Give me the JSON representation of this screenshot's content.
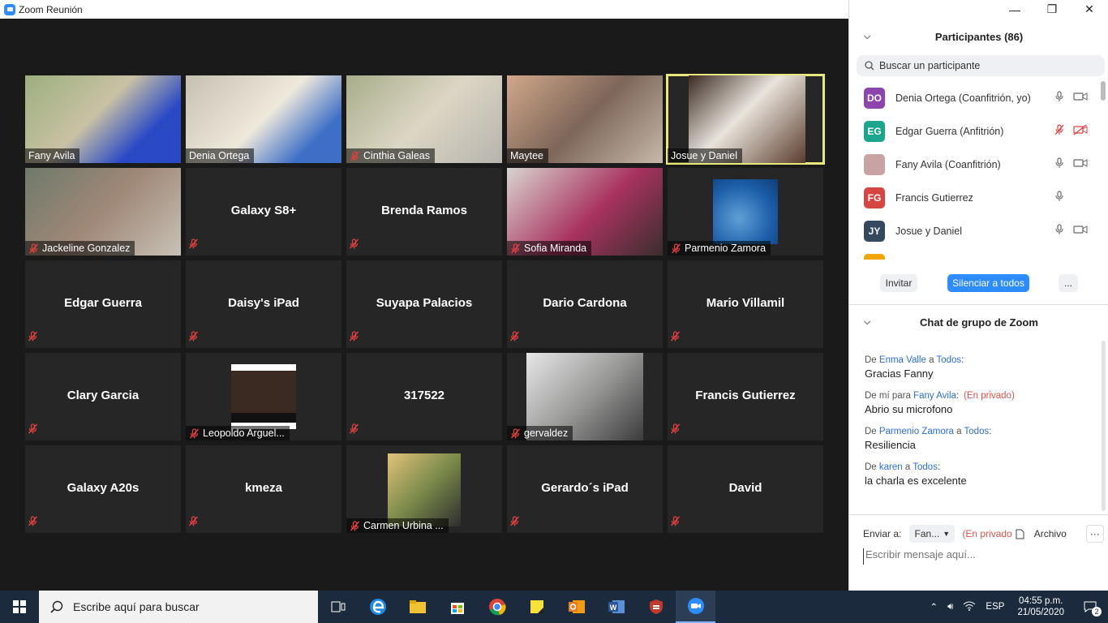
{
  "window": {
    "title": "Zoom Reunión",
    "minimize": "—",
    "restore": "❐",
    "close": "✕"
  },
  "tiles": [
    {
      "name": "Fany Avila",
      "muted": false,
      "video": true
    },
    {
      "name": "Denia Ortega",
      "muted": false,
      "video": true
    },
    {
      "name": "Cinthia Galeas",
      "muted": true,
      "video": true
    },
    {
      "name": "Maytee",
      "muted": false,
      "video": true
    },
    {
      "name": "Josue y Daniel",
      "muted": false,
      "video": true,
      "active": true
    },
    {
      "name": "Jackeline Gonzalez",
      "muted": true,
      "video": true
    },
    {
      "name": "Galaxy S8+",
      "muted": true,
      "video": false
    },
    {
      "name": "Brenda Ramos",
      "muted": true,
      "video": false
    },
    {
      "name": "Sofia Miranda",
      "muted": true,
      "video": true
    },
    {
      "name": "Parmenio Zamora",
      "muted": true,
      "video": false,
      "photo": true
    },
    {
      "name": "Edgar Guerra",
      "muted": true,
      "video": false
    },
    {
      "name": "Daisy's iPad",
      "muted": true,
      "video": false
    },
    {
      "name": "Suyapa Palacios",
      "muted": true,
      "video": false
    },
    {
      "name": "Dario Cardona",
      "muted": true,
      "video": false
    },
    {
      "name": "Mario Villamil",
      "muted": true,
      "video": false
    },
    {
      "name": "Clary Garcia",
      "muted": true,
      "video": false
    },
    {
      "name": "Leopoldo Arguel...",
      "muted": true,
      "video": false,
      "photo": true
    },
    {
      "name": "317522",
      "muted": true,
      "video": false
    },
    {
      "name": "gervaldez",
      "muted": true,
      "video": true
    },
    {
      "name": "Francis Gutierrez",
      "muted": true,
      "video": false
    },
    {
      "name": "Galaxy A20s",
      "muted": true,
      "video": false
    },
    {
      "name": "kmeza",
      "muted": true,
      "video": false
    },
    {
      "name": "Carmen Urbina ...",
      "muted": true,
      "video": false,
      "photo": true
    },
    {
      "name": "Gerardo´s iPad",
      "muted": true,
      "video": false
    },
    {
      "name": "David",
      "muted": true,
      "video": false
    }
  ],
  "participants_panel": {
    "title": "Participantes (86)",
    "search_placeholder": "Buscar un participante",
    "items": [
      {
        "initials": "DO",
        "color": "#8e44ad",
        "name": "Denia Ortega (Coanfitrión, yo)",
        "mic_muted": false,
        "cam_off": false
      },
      {
        "initials": "EG",
        "color": "#1aa58c",
        "name": "Edgar Guerra (Anfitrión)",
        "mic_muted": true,
        "cam_off": true
      },
      {
        "initials": "",
        "color": "#c9a3a3",
        "name": "Fany Avila (Coanfitrión)",
        "mic_muted": false,
        "cam_off": false
      },
      {
        "initials": "FG",
        "color": "#d64541",
        "name": "Francis Gutierrez",
        "mic_muted": false,
        "cam_off": null
      },
      {
        "initials": "JY",
        "color": "#34495e",
        "name": "Josue y Daniel",
        "mic_muted": false,
        "cam_off": false
      }
    ],
    "invite": "Invitar",
    "mute_all": "Silenciar a todos",
    "more": "..."
  },
  "chat": {
    "title": "Chat de grupo de Zoom",
    "messages": [
      {
        "prefix": "De ",
        "from": "Enma Valle",
        "mid": " a ",
        "to": "Todos",
        "suffix": ":",
        "private": "",
        "text": "Gracias Fanny"
      },
      {
        "prefix": "De mí para ",
        "from": "Fany Avila",
        "mid": "",
        "to": "",
        "suffix": ":",
        "private": "(En privado)",
        "text": "Abrio su microfono"
      },
      {
        "prefix": "De ",
        "from": "Parmenio Zamora",
        "mid": " a ",
        "to": "Todos",
        "suffix": ":",
        "private": "",
        "text": "Resiliencia"
      },
      {
        "prefix": "De ",
        "from": "karen",
        "mid": " a ",
        "to": "Todos",
        "suffix": ":",
        "private": "",
        "text": "la charla es excelente"
      }
    ],
    "send_to_label": "Enviar a:",
    "send_to_value": "Fan...",
    "private_label": "(En privado",
    "file_label": "Archivo",
    "more": "···",
    "input_placeholder": "Escribir mensaje aquí..."
  },
  "taskbar": {
    "search_placeholder": "Escribe aquí para buscar",
    "language": "ESP",
    "time": "04:55 p.m.",
    "date": "21/05/2020",
    "notifications": "2"
  }
}
